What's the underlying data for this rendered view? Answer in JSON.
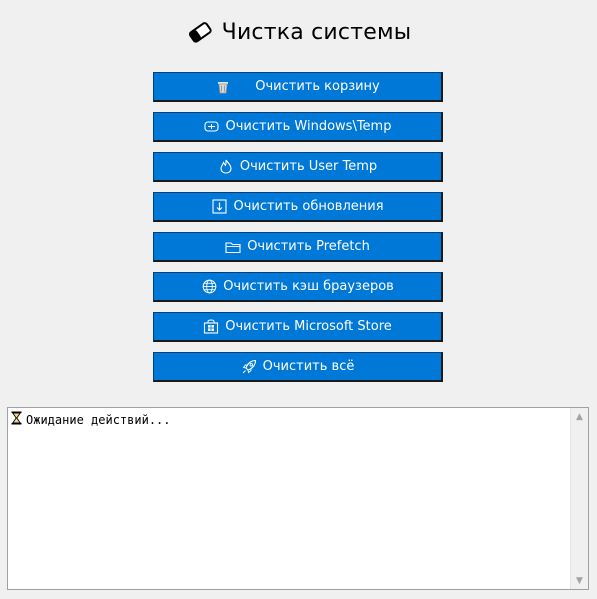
{
  "header": {
    "title": "Чистка системы",
    "icon": "eraser-icon"
  },
  "buttons": [
    {
      "label": "Очистить корзину",
      "icon": "trash-icon"
    },
    {
      "label": "Очистить Windows\\Temp",
      "icon": "drive-icon"
    },
    {
      "label": "Очистить User Temp",
      "icon": "flame-icon"
    },
    {
      "label": "Очистить обновления",
      "icon": "download-icon"
    },
    {
      "label": "Очистить Prefetch",
      "icon": "folder-icon"
    },
    {
      "label": "Очистить кэш браузеров",
      "icon": "globe-icon"
    },
    {
      "label": "Очистить Microsoft Store",
      "icon": "store-icon"
    },
    {
      "label": "Очистить всё",
      "icon": "rocket-icon"
    }
  ],
  "log": {
    "text": "Ожидание действий...",
    "icon": "hourglass-icon"
  },
  "colors": {
    "button_bg": "#0078d7",
    "button_text": "#ffffff",
    "window_bg": "#f0f0f0"
  }
}
